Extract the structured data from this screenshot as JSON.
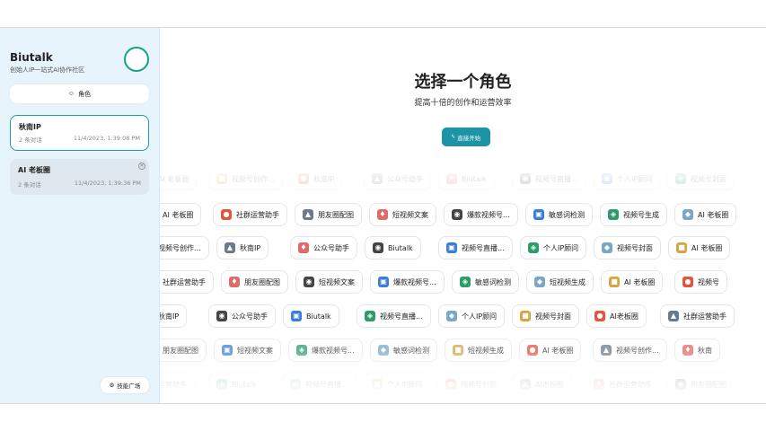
{
  "sidebar": {
    "brand": "Biutalk",
    "tagline": "创始人IP一站式AI协作社区",
    "role_button": "角色",
    "plugins_button": "技能广场",
    "chats": [
      {
        "title": "秋南IP",
        "count": "2 条对话",
        "time": "11/4/2023, 1:39:08 PM"
      },
      {
        "title": "AI 老板圈",
        "count": "2 条对话",
        "time": "11/4/2023, 1:39:36 PM"
      }
    ]
  },
  "main": {
    "title": "选择一个角色",
    "subtitle": "提高十倍的创作和运营效率",
    "start_button": "直接开始"
  },
  "roles": {
    "r1": [
      "AI 老板圈",
      "视频号创作...",
      "秋南IP",
      "公众号助手",
      "Biutalk",
      "视频号直播...",
      "个人IP顾问",
      "视频号封面"
    ],
    "r2": [
      "AI 老板圈",
      "社群运营助手",
      "朋友圈配图",
      "短视频文案",
      "爆款视频号...",
      "敏感词检测",
      "视频号生成",
      "AI 老板圈"
    ],
    "r3": [
      "视频号创作...",
      "秋南IP",
      "公众号助手",
      "Biutalk",
      "视频号直播...",
      "个人IP顾问",
      "视频号封面",
      "AI 老板圈"
    ],
    "r4": [
      "社群运营助手",
      "朋友圈配图",
      "短视频文案",
      "爆款视频号...",
      "敏感词检测",
      "短视频生成",
      "AI 老板圈",
      "视频号"
    ],
    "r5": [
      "秋南IP",
      "公众号助手",
      "Biutalk",
      "视频号直播...",
      "个人IP顾问",
      "视频号封面",
      "AI老板圈",
      "社群运营助手"
    ],
    "r6": [
      "朋友圈配图",
      "短视频文案",
      "爆款视频号...",
      "敏感词检测",
      "短视频生成",
      "AI 老板圈",
      "视频号创作...",
      "秋南"
    ],
    "r7": [
      "运营助手",
      "Biutalk",
      "视频号直播...",
      "个人IP顾问",
      "视频号封面",
      "AI老板圈",
      "社群运营助手",
      "朋友圈配图"
    ]
  },
  "colors": {
    "accent": "#1d93a6",
    "active_border": "#1aa0a0"
  }
}
